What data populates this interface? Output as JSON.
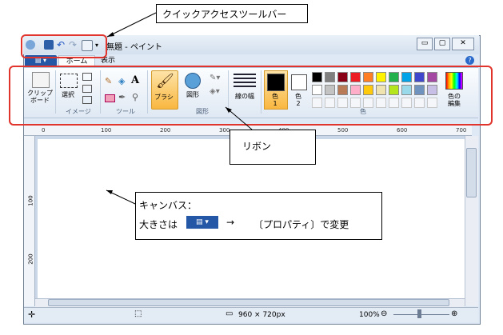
{
  "window": {
    "title": "無題 - ペイント",
    "controls": {
      "minimize": "▭",
      "maximize": "▢",
      "close": "✕"
    }
  },
  "tabs": {
    "app_menu": "▤ ▾",
    "home": "ホーム",
    "view": "表示",
    "help": "?"
  },
  "ribbon": {
    "clipboard_label": "クリップ\nボード",
    "image": {
      "select_label": "選択",
      "group_label": "イメージ"
    },
    "tools": {
      "group_label": "ツール"
    },
    "brush_label": "ブラシ",
    "shapes": {
      "shapes_label": "図形",
      "group_label": "図形"
    },
    "line_width_label": "線の幅",
    "colors": {
      "color1_label": "色\n1",
      "color2_label": "色\n2",
      "edit_colors_label": "色の\n編集",
      "group_label": "色",
      "swatches_row1": [
        "#000000",
        "#7f7f7f",
        "#880015",
        "#ed1c24",
        "#ff7f27",
        "#fff200",
        "#22b14c",
        "#00a2e8",
        "#3f48cc",
        "#a349a4"
      ],
      "swatches_row2": [
        "#ffffff",
        "#c3c3c3",
        "#b97a57",
        "#ffaec9",
        "#ffc90e",
        "#efe4b0",
        "#b5e61d",
        "#99d9ea",
        "#7092be",
        "#c8bfe7"
      ],
      "color1_value": "#000000",
      "color2_value": "#ffffff"
    }
  },
  "ruler": {
    "h_ticks": [
      "0",
      "100",
      "200",
      "300",
      "400",
      "500",
      "600",
      "700"
    ],
    "v_ticks": [
      "100",
      "200"
    ]
  },
  "status": {
    "size": "960 × 720px",
    "zoom": "100%",
    "minus": "⊖",
    "plus": "⊕"
  },
  "annotations": {
    "qat": "クイックアクセスツールバー",
    "ribbon": "リボン",
    "canvas_line1": "キャンバス：",
    "canvas_line2_a": "大きさは",
    "canvas_line2_arrow": "→",
    "canvas_line2_b": "〔プロパティ〕で変更",
    "canvas_button": "▤ ▾"
  },
  "colors": {
    "highlight": "#e0342d",
    "accent": "#2457a6",
    "brush_active": "#f9b740"
  }
}
